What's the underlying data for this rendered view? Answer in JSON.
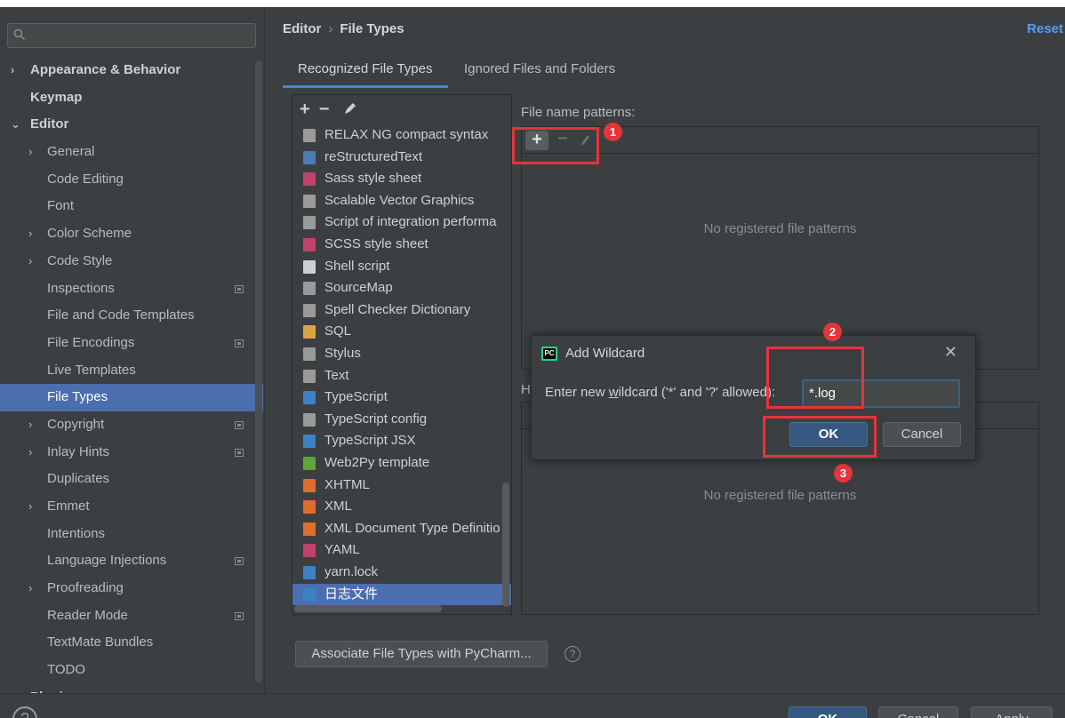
{
  "sidebar": {
    "search_placeholder": "Q▾",
    "items": [
      {
        "label": "Appearance & Behavior",
        "arrow": "›",
        "indent": 0,
        "bold": true,
        "badge": false
      },
      {
        "label": "Keymap",
        "arrow": "",
        "indent": 0,
        "bold": true,
        "badge": false
      },
      {
        "label": "Editor",
        "arrow": "⌄",
        "indent": 0,
        "bold": true,
        "badge": false
      },
      {
        "label": "General",
        "arrow": "›",
        "indent": 1,
        "bold": false,
        "badge": false
      },
      {
        "label": "Code Editing",
        "arrow": "",
        "indent": 1,
        "bold": false,
        "badge": false
      },
      {
        "label": "Font",
        "arrow": "",
        "indent": 1,
        "bold": false,
        "badge": false
      },
      {
        "label": "Color Scheme",
        "arrow": "›",
        "indent": 1,
        "bold": false,
        "badge": false
      },
      {
        "label": "Code Style",
        "arrow": "›",
        "indent": 1,
        "bold": false,
        "badge": false
      },
      {
        "label": "Inspections",
        "arrow": "",
        "indent": 1,
        "bold": false,
        "badge": true
      },
      {
        "label": "File and Code Templates",
        "arrow": "",
        "indent": 1,
        "bold": false,
        "badge": false
      },
      {
        "label": "File Encodings",
        "arrow": "",
        "indent": 1,
        "bold": false,
        "badge": true
      },
      {
        "label": "Live Templates",
        "arrow": "",
        "indent": 1,
        "bold": false,
        "badge": false
      },
      {
        "label": "File Types",
        "arrow": "",
        "indent": 1,
        "bold": false,
        "badge": false,
        "selected": true
      },
      {
        "label": "Copyright",
        "arrow": "›",
        "indent": 1,
        "bold": false,
        "badge": true
      },
      {
        "label": "Inlay Hints",
        "arrow": "›",
        "indent": 1,
        "bold": false,
        "badge": true
      },
      {
        "label": "Duplicates",
        "arrow": "",
        "indent": 1,
        "bold": false,
        "badge": false
      },
      {
        "label": "Emmet",
        "arrow": "›",
        "indent": 1,
        "bold": false,
        "badge": false
      },
      {
        "label": "Intentions",
        "arrow": "",
        "indent": 1,
        "bold": false,
        "badge": false
      },
      {
        "label": "Language Injections",
        "arrow": "",
        "indent": 1,
        "bold": false,
        "badge": true
      },
      {
        "label": "Proofreading",
        "arrow": "›",
        "indent": 1,
        "bold": false,
        "badge": false
      },
      {
        "label": "Reader Mode",
        "arrow": "",
        "indent": 1,
        "bold": false,
        "badge": true
      },
      {
        "label": "TextMate Bundles",
        "arrow": "",
        "indent": 1,
        "bold": false,
        "badge": false
      },
      {
        "label": "TODO",
        "arrow": "",
        "indent": 1,
        "bold": false,
        "badge": false
      },
      {
        "label": "Plugins",
        "arrow": "",
        "indent": 0,
        "bold": true,
        "badge": true
      }
    ]
  },
  "breadcrumb": {
    "parent": "Editor",
    "separator": "›",
    "current": "File Types"
  },
  "reset_label": "Reset",
  "tabs": [
    {
      "label": "Recognized File Types",
      "active": true
    },
    {
      "label": "Ignored Files and Folders",
      "active": false
    }
  ],
  "toolbar": {
    "add": "+",
    "remove": "−"
  },
  "file_types": [
    {
      "label": "RELAX NG compact syntax",
      "color": "#9a9a9a"
    },
    {
      "label": "reStructuredText",
      "color": "#4a7cb5"
    },
    {
      "label": "Sass style sheet",
      "color": "#c0416b"
    },
    {
      "label": "Scalable Vector Graphics",
      "color": "#9a9a9a"
    },
    {
      "label": "Script of integration performa",
      "color": "#9a9a9a"
    },
    {
      "label": "SCSS style sheet",
      "color": "#c0416b"
    },
    {
      "label": "Shell script",
      "color": "#cfcfcf"
    },
    {
      "label": "SourceMap",
      "color": "#9a9a9a"
    },
    {
      "label": "Spell Checker Dictionary",
      "color": "#9a9a9a"
    },
    {
      "label": "SQL",
      "color": "#d9a441"
    },
    {
      "label": "Stylus",
      "color": "#9a9a9a"
    },
    {
      "label": "Text",
      "color": "#9a9a9a"
    },
    {
      "label": "TypeScript",
      "color": "#3c82c4"
    },
    {
      "label": "TypeScript config",
      "color": "#9a9a9a"
    },
    {
      "label": "TypeScript JSX",
      "color": "#3c82c4"
    },
    {
      "label": "Web2Py template",
      "color": "#5fa33a"
    },
    {
      "label": "XHTML",
      "color": "#e06c2d"
    },
    {
      "label": "XML",
      "color": "#e06c2d"
    },
    {
      "label": "XML Document Type Definitio",
      "color": "#e06c2d"
    },
    {
      "label": "YAML",
      "color": "#c0416b"
    },
    {
      "label": "yarn.lock",
      "color": "#3c82c4"
    },
    {
      "label": "日志文件",
      "color": "#3c82c4",
      "selected": true
    }
  ],
  "patterns": {
    "label": "File name patterns:",
    "empty_text": "No registered file patterns"
  },
  "hashbang": {
    "label": "H",
    "empty_text": "No registered file patterns"
  },
  "associate_button": "Associate File Types with PyCharm...",
  "help_glyph": "?",
  "dialog": {
    "title": "Add Wildcard",
    "prompt_before": "Enter new ",
    "prompt_mnemonic": "w",
    "prompt_after": "ildcard ('*' and '?' allowed):",
    "input_value": "*.log",
    "ok": "OK",
    "cancel": "Cancel",
    "close": "✕"
  },
  "annotations": [
    "1",
    "2",
    "3"
  ],
  "bottom": {
    "help": "?",
    "ok": "OK",
    "cancel": "Cancel",
    "apply": "Apply"
  },
  "colors": {
    "accent": "#4b6eaf",
    "link": "#589df6",
    "annotation": "#e5353a",
    "primary_button": "#365880"
  }
}
